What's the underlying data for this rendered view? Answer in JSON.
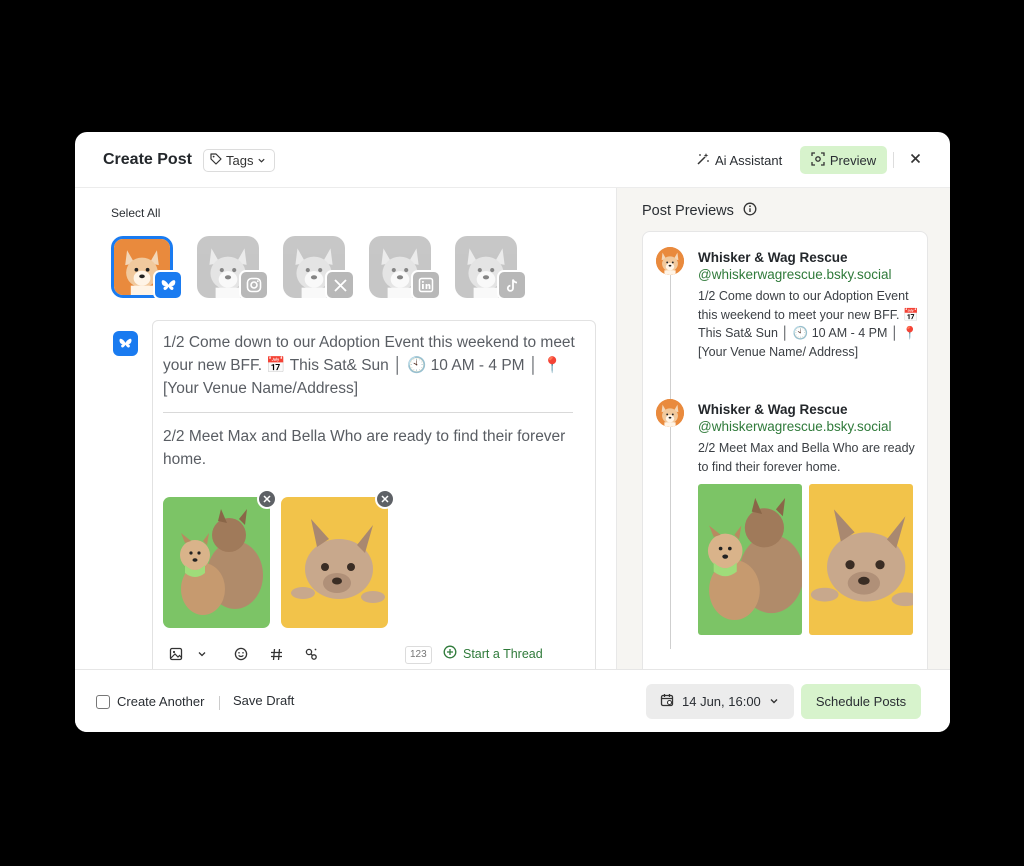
{
  "header": {
    "title": "Create Post",
    "tags_label": "Tags",
    "ai_label": "Ai Assistant",
    "preview_label": "Preview"
  },
  "composer": {
    "select_all": "Select All",
    "accounts": [
      {
        "network": "bluesky",
        "selected": true
      },
      {
        "network": "instagram",
        "selected": false
      },
      {
        "network": "x",
        "selected": false
      },
      {
        "network": "linkedin",
        "selected": false
      },
      {
        "network": "tiktok",
        "selected": false
      }
    ],
    "post1": "1/2 Come down to our Adoption Event this weekend to meet your new BFF. 📅 This Sat& Sun │ 🕙 10 AM - 4 PM │ 📍 [Your Venue Name/Address]",
    "post2": "2/2 Meet Max and Bella Who are ready to find their forever home.",
    "char_count": "123",
    "thread_label": "Start a Thread"
  },
  "preview": {
    "title": "Post Previews",
    "posts": [
      {
        "name": "Whisker & Wag Rescue",
        "handle": "@whiskerwagrescue.bsky.social",
        "text": "1/2 Come down to our Adoption Event this weekend to meet your new BFF. 📅 This Sat& Sun │ 🕙 10 AM - 4 PM │ 📍 [Your Venue Name/ Address]"
      },
      {
        "name": "Whisker & Wag Rescue",
        "handle": "@whiskerwagrescue.bsky.social",
        "text": "2/2 Meet Max and Bella Who are ready to find their forever home."
      }
    ]
  },
  "footer": {
    "create_another": "Create Another",
    "save_draft": "Save Draft",
    "date": "14 Jun, 16:00",
    "schedule": "Schedule Posts"
  },
  "colors": {
    "accent_green": "#d7f3cc",
    "link_green": "#2f7a3a",
    "bluesky_blue": "#1a7bf0"
  }
}
